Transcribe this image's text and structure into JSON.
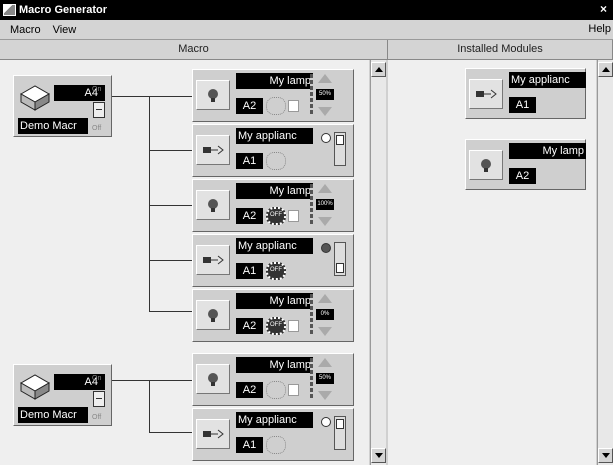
{
  "window": {
    "title": "Macro Generator",
    "close_glyph": "×"
  },
  "menu": {
    "items": [
      "Macro",
      "View"
    ],
    "help": "Help"
  },
  "columns": {
    "macro": "Macro",
    "installed": "Installed Modules"
  },
  "macros": [
    {
      "address": "A4",
      "name": "Demo Macr",
      "on_label": "On",
      "off_label": "Off",
      "steps": [
        {
          "type": "lamp",
          "name": "My lamp",
          "address": "A2",
          "level": "50%",
          "icon": "lamp-icon"
        },
        {
          "type": "appliance",
          "name": "My applianc",
          "address": "A1",
          "state": "off",
          "icon": "appliance-plug-icon"
        },
        {
          "type": "lamp",
          "name": "My lamp",
          "address": "A2",
          "level": "100%",
          "ring": "OFF",
          "icon": "lamp-icon"
        },
        {
          "type": "appliance",
          "name": "My applianc",
          "address": "A1",
          "state": "on",
          "ring": "OFF",
          "icon": "appliance-plug-icon"
        },
        {
          "type": "lamp",
          "name": "My lamp",
          "address": "A2",
          "level": "0%",
          "ring": "OFF",
          "icon": "lamp-icon"
        }
      ]
    },
    {
      "address": "A4",
      "name": "Demo Macr",
      "on_label": "On",
      "off_label": "Off",
      "steps": [
        {
          "type": "lamp",
          "name": "My lamp",
          "address": "A2",
          "level": "50%",
          "icon": "lamp-icon"
        },
        {
          "type": "appliance",
          "name": "My applianc",
          "address": "A1",
          "state": "off",
          "icon": "appliance-plug-icon"
        }
      ]
    }
  ],
  "installed_modules": [
    {
      "type": "appliance",
      "name": "My applianc",
      "address": "A1",
      "icon": "appliance-plug-icon"
    },
    {
      "type": "lamp",
      "name": "My lamp",
      "address": "A2",
      "icon": "lamp-icon"
    }
  ]
}
